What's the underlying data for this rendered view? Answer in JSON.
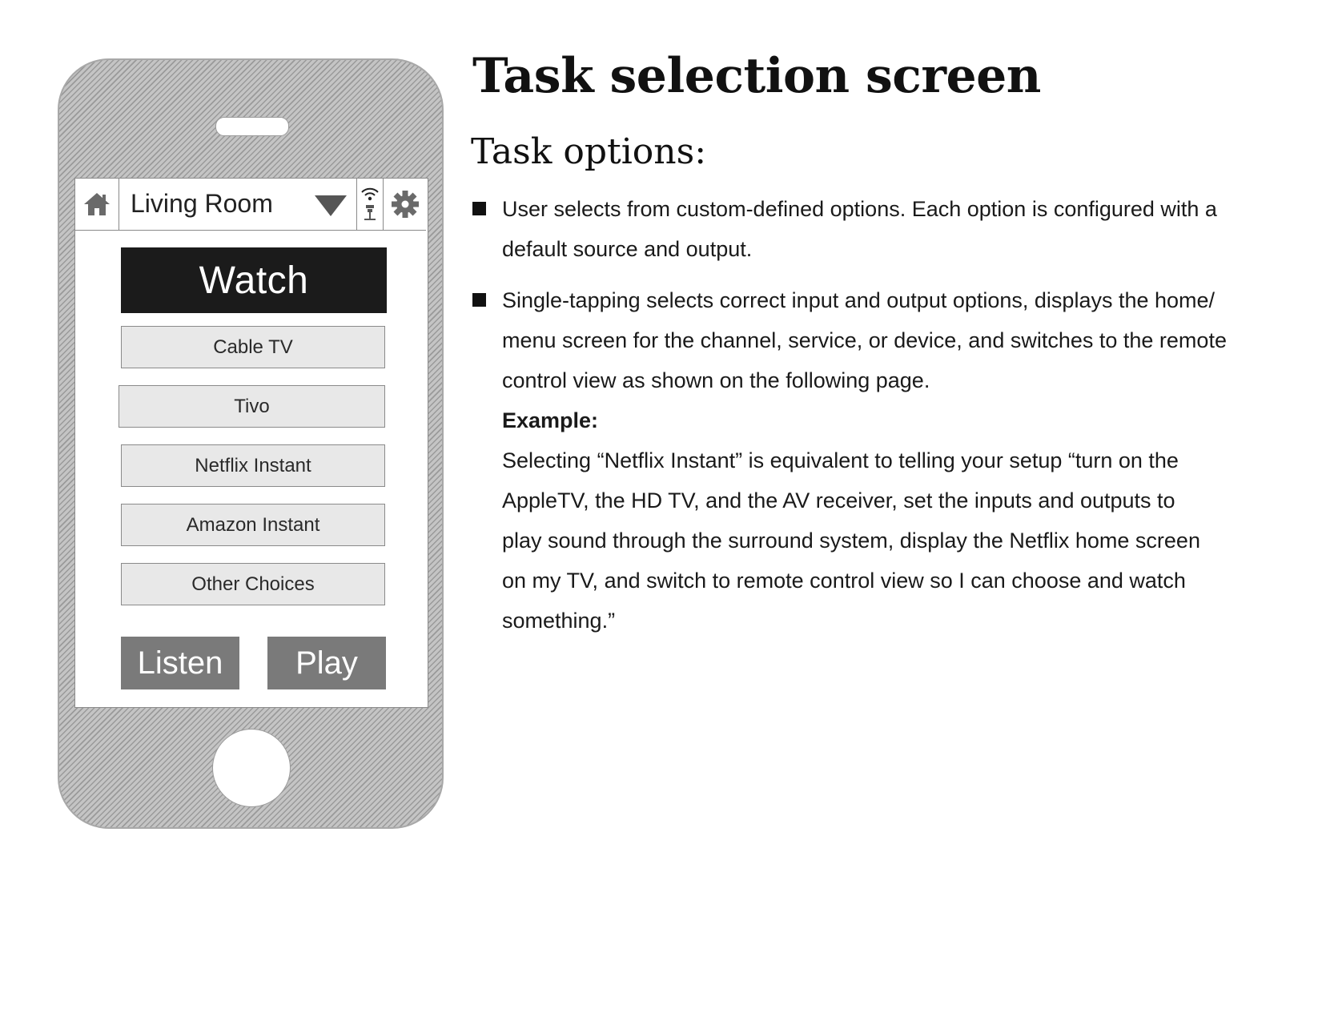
{
  "phone": {
    "top_bar": {
      "home_icon": "home-icon",
      "room_label": "Living Room",
      "dropdown_icon": "chevron-down-icon",
      "signal_icon": "wifi-signal-icon",
      "settings_icon": "gear-icon"
    },
    "category_header": "Watch",
    "options": [
      {
        "label": "Cable TV"
      },
      {
        "label": "Tivo"
      },
      {
        "label": "Netflix Instant"
      },
      {
        "label": "Amazon Instant"
      },
      {
        "label": "Other Choices"
      }
    ],
    "bottom_buttons": {
      "listen": "Listen",
      "play": "Play"
    },
    "colors": {
      "header_bg": "#1b1b1b",
      "option_bg": "#e8e8e8",
      "bottom_button_bg": "#7a7a7a",
      "phone_body": "#b8b8b8"
    }
  },
  "doc": {
    "title": "Task selection screen",
    "section": "Task options:",
    "bullets": [
      {
        "lines": [
          "User selects from custom-defined options. Each option is configured with a",
          "default source and output."
        ]
      },
      {
        "lines": [
          "Single-tapping selects correct input and output options, displays the home/",
          "menu screen for the channel, service, or device, and switches to the remote",
          "control view as shown on the following page."
        ],
        "example_label": "Example:",
        "example_lines": [
          "Selecting “Netflix Instant” is equivalent to telling your setup “turn on the",
          "AppleTV, the HD TV, and the AV receiver, set the inputs and outputs to",
          "play sound through the surround system, display the Netflix home screen",
          "on my TV, and switch to remote control view so I can choose and watch",
          "something.”"
        ]
      }
    ]
  }
}
